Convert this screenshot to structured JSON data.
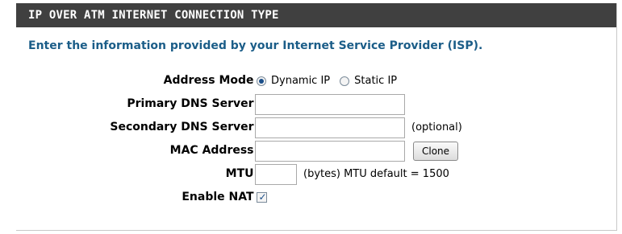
{
  "header": {
    "title": "IP OVER ATM INTERNET CONNECTION TYPE"
  },
  "intro": "Enter the information provided by your Internet Service Provider (ISP).",
  "fields": {
    "address_mode": {
      "label": "Address Mode :",
      "options": [
        "Dynamic IP",
        "Static IP"
      ],
      "selected": "Dynamic IP"
    },
    "primary_dns": {
      "label": "Primary DNS Server :",
      "value": ""
    },
    "secondary_dns": {
      "label": "Secondary DNS Server :",
      "value": "",
      "suffix": "(optional)"
    },
    "mac": {
      "label": "MAC Address :",
      "value": "",
      "clone_label": "Clone"
    },
    "mtu": {
      "label": "MTU :",
      "value": "",
      "suffix": "(bytes) MTU default = 1500"
    },
    "nat": {
      "label": "Enable NAT :",
      "checked": true,
      "check_glyph": "✓"
    }
  },
  "colors": {
    "header_bg": "#404040",
    "intro_text": "#1b5d88"
  }
}
